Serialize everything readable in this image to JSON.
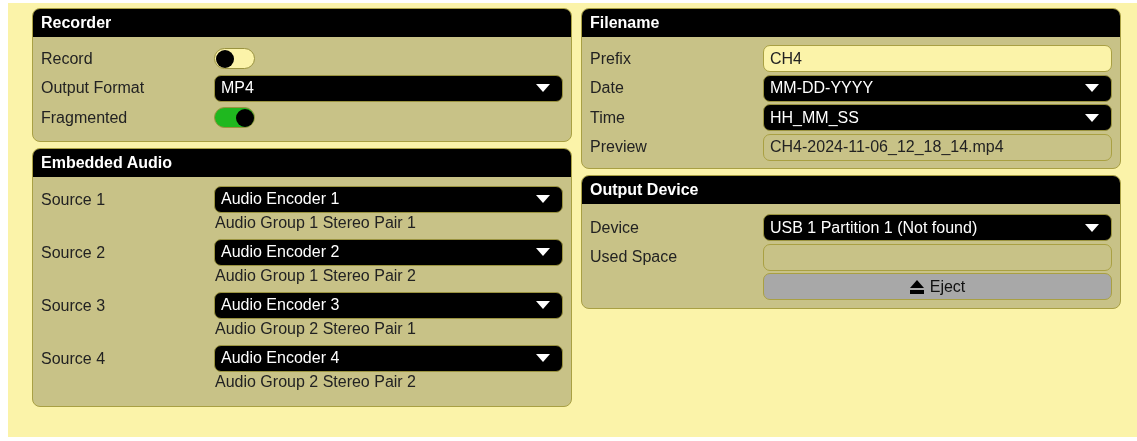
{
  "recorder": {
    "title": "Recorder",
    "rows": [
      {
        "kind": "toggle",
        "label": "Record",
        "on": false
      },
      {
        "kind": "select",
        "label": "Output Format",
        "value": "MP4"
      },
      {
        "kind": "toggle",
        "label": "Fragmented",
        "on": true
      }
    ]
  },
  "embedded_audio": {
    "title": "Embedded Audio",
    "sources": [
      {
        "label": "Source 1",
        "value": "Audio Encoder 1",
        "note": "Audio Group 1 Stereo Pair 1"
      },
      {
        "label": "Source 2",
        "value": "Audio Encoder 2",
        "note": "Audio Group 1 Stereo Pair 2"
      },
      {
        "label": "Source 3",
        "value": "Audio Encoder 3",
        "note": "Audio Group 2 Stereo Pair 1"
      },
      {
        "label": "Source 4",
        "value": "Audio Encoder 4",
        "note": "Audio Group 2 Stereo Pair 2"
      }
    ]
  },
  "filename": {
    "title": "Filename",
    "rows": [
      {
        "kind": "input",
        "label": "Prefix",
        "value": "CH4"
      },
      {
        "kind": "select",
        "label": "Date",
        "value": "MM-DD-YYYY"
      },
      {
        "kind": "select",
        "label": "Time",
        "value": "HH_MM_SS"
      },
      {
        "kind": "readonly",
        "label": "Preview",
        "value": "CH4-2024-11-06_12_18_14.mp4"
      }
    ]
  },
  "output_device": {
    "title": "Output Device",
    "rows": [
      {
        "kind": "select",
        "label": "Device",
        "value": "USB 1 Partition 1 (Not found)"
      },
      {
        "kind": "readonly",
        "label": "Used Space"
      },
      {
        "kind": "button",
        "value": "Eject"
      }
    ]
  }
}
